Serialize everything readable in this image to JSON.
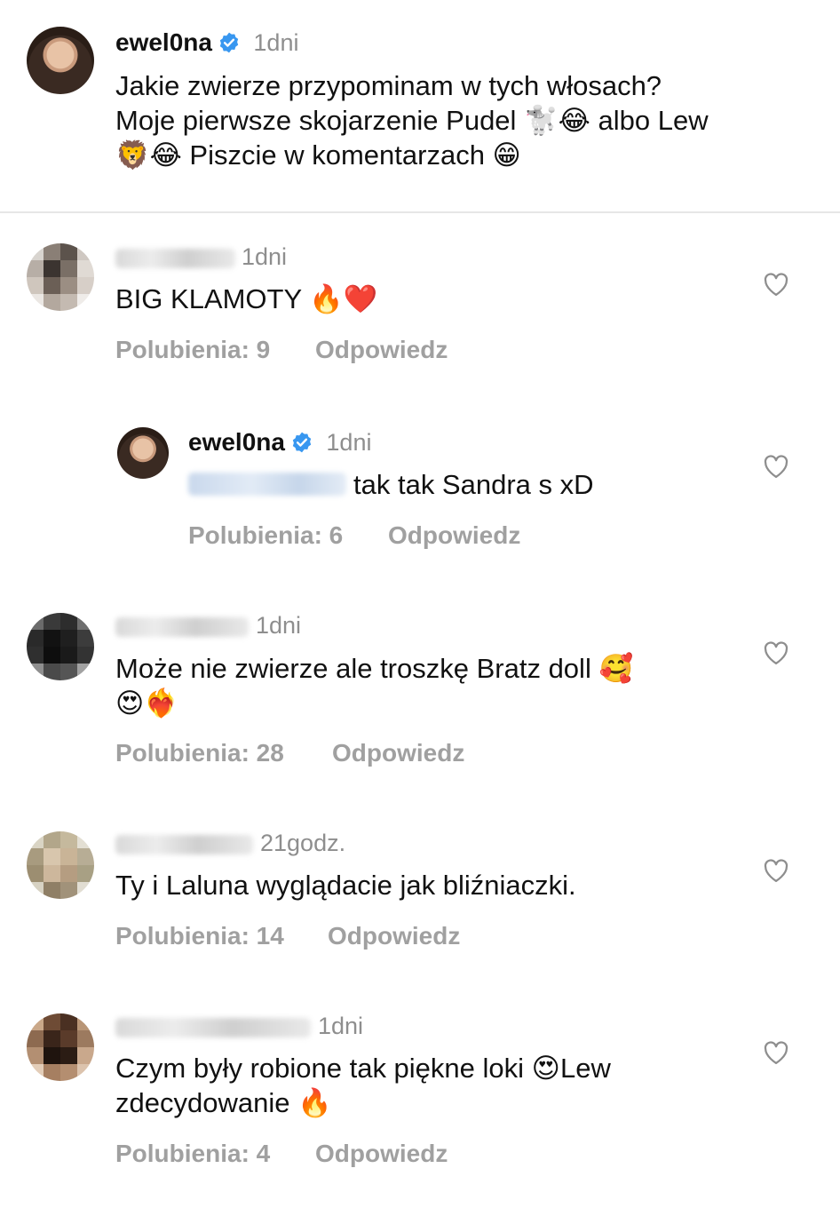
{
  "post": {
    "username": "ewel0na",
    "time": "1dni",
    "caption_line1": "Jakie zwierze przypominam w tych włosach?",
    "caption_line2": "Moje pierwsze skojarzenie Pudel 🐩😂 albo Lew",
    "caption_line3": "🦁😂 Piszcie w komentarzach 😁"
  },
  "comments": [
    {
      "time": "1dni",
      "text": "BIG KLAMOTY 🔥❤️",
      "likes": "Polubienia: 9",
      "reply": "Odpowiedz"
    },
    {
      "username": "ewel0na",
      "time": "1dni",
      "text": "tak tak Sandra s xD",
      "likes": "Polubienia: 6",
      "reply": "Odpowiedz"
    },
    {
      "time": "1dni",
      "text_line1": "Może nie zwierze ale troszkę  Bratz doll 🥰",
      "text_line2": "😍❤️‍🔥",
      "likes": "Polubienia: 28",
      "reply": "Odpowiedz"
    },
    {
      "time": "21godz.",
      "text": "Ty i Laluna wyglądacie jak bliźniaczki.",
      "likes": "Polubienia: 14",
      "reply": "Odpowiedz"
    },
    {
      "time": "1dni",
      "text_line1": "Czym były robione tak piękne loki 😍Lew",
      "text_line2": "zdecydowanie 🔥",
      "likes": "Polubienia: 4",
      "reply": "Odpowiedz"
    }
  ],
  "icons": {
    "verified": "verified-badge-icon",
    "heart": "heart-outline-icon"
  },
  "colors": {
    "verified_blue": "#3897f0",
    "meta_gray": "#a0a0a0",
    "time_gray": "#8e8e8e"
  }
}
